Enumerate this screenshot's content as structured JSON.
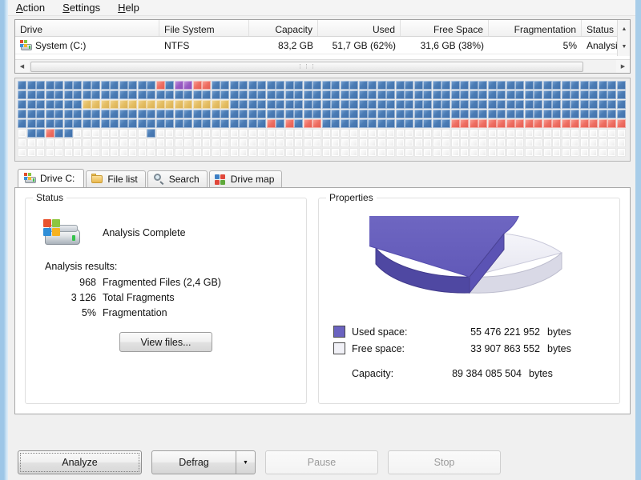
{
  "menubar": {
    "items": [
      {
        "name": "action",
        "acc": "A",
        "rest": "ction"
      },
      {
        "name": "settings",
        "acc": "S",
        "rest": "ettings"
      },
      {
        "name": "help",
        "acc": "H",
        "rest": "elp"
      }
    ]
  },
  "drive_table": {
    "columns": [
      "Drive",
      "File System",
      "Capacity",
      "Used",
      "Free Space",
      "Fragmentation",
      "Status"
    ],
    "rows": [
      {
        "drive": "System (C:)",
        "file_system": "NTFS",
        "capacity": "83,2 GB",
        "used": "51,7 GB (62%)",
        "free_space": "31,6 GB (38%)",
        "fragmentation": "5%",
        "status": "Analysis"
      }
    ],
    "hscroll_grip": "⋮⋮⋮",
    "scroll_up_icon": "▲",
    "scroll_down_icon": "▼",
    "scroll_left_icon": "◀",
    "scroll_right_icon": "▶"
  },
  "block_map": {
    "colors": {
      "blue": "#4b7cb5",
      "red": "#ef6f63",
      "purple": "#9a5cc4",
      "yellow": "#e4be63",
      "white": "#f4f4f4"
    },
    "columns": 66,
    "rows": [
      "bbbbbbbbbbbbbbbrbpprRbbbbbbbbbbbbbbbbbbbbbbbbbbbbbbbbbbbbbbbbbbbbb",
      "bbbbbbbbbbbbbbbbbbbbbbbbbbbbbbbbbbbbbbbbbbbbbbbbbbbbbbbbbbbbbbbbbb",
      "bbbbbbbyyyyyyyyyyyyyyyybbbbbbbbbbbbbbbbbbbbbbbbbbbbbbbbbbbbbbbbbbb",
      "bbbbbbbbbbbbbbbbbbbbbbbbbbbbbbbbbbbbbbbbbbbbbbbbbbbbbbbbbbbbbbbbbb",
      "bbbbbbbbbbbbbbbbbbbbbbbbbbbrbrbrrbbbbbbbbbbbbbbrrrrrrrrrrrrrrrrrrr",
      "wbbrbbwwwwwwwwbwwwwwwwwwwwwwwwwwwwwwwwwwwwwwwwwwwwwwwwwwwwwwwwwwww",
      "wwwwwwwwwwwwwwwwwwwwwwwwwwwwwwwwwwwwwwwwwwwwwwwwwwwwwwwwwwwwwwwwww",
      "wwwwwwwwwwwwwwwwwwwwwwwwwwwwwwwwwwwwwwwwwwwwwwwwwwwwwwwwwwwwwwwwww"
    ]
  },
  "tabs": [
    {
      "label": "Drive C:",
      "icon": "drive-icon",
      "active": true
    },
    {
      "label": "File list",
      "icon": "folder-icon",
      "active": false
    },
    {
      "label": "Search",
      "icon": "magnifier-icon",
      "active": false
    },
    {
      "label": "Drive map",
      "icon": "blocks-icon",
      "active": false
    }
  ],
  "status_group": {
    "legend": "Status",
    "headline": "Analysis Complete",
    "results_label": "Analysis results:",
    "results": [
      {
        "value": "968",
        "label": "Fragmented Files (2,4 GB)"
      },
      {
        "value": "3 126",
        "label": "Total Fragments"
      },
      {
        "value": "5%",
        "label": "Fragmentation"
      }
    ],
    "view_files_label": "View files..."
  },
  "properties_group": {
    "legend": "Properties",
    "legend_rows": [
      {
        "swatch": "#6b63c0",
        "label": "Used space:",
        "value": "55 476 221 952",
        "unit": "bytes"
      },
      {
        "swatch": "#f1f1f7",
        "label": "Free space:",
        "value": "33 907 863 552",
        "unit": "bytes"
      }
    ],
    "capacity_row": {
      "label": "Capacity:",
      "value": "89 384 085 504",
      "unit": "bytes"
    }
  },
  "chart_data": {
    "type": "pie",
    "title": "Properties",
    "labels": [
      "Used space",
      "Free space"
    ],
    "values": [
      55476221952,
      33907863552
    ],
    "percentages": [
      62,
      38
    ],
    "colors": [
      "#6b63c0",
      "#f1f1f7"
    ],
    "units": "bytes",
    "total": 89384085504,
    "total_label": "Capacity",
    "legend_position": "bottom-left",
    "three_d": true
  },
  "bottom_buttons": {
    "analyze": "Analyze",
    "defrag": "Defrag",
    "defrag_arrow": "▼",
    "pause": "Pause",
    "stop": "Stop"
  }
}
